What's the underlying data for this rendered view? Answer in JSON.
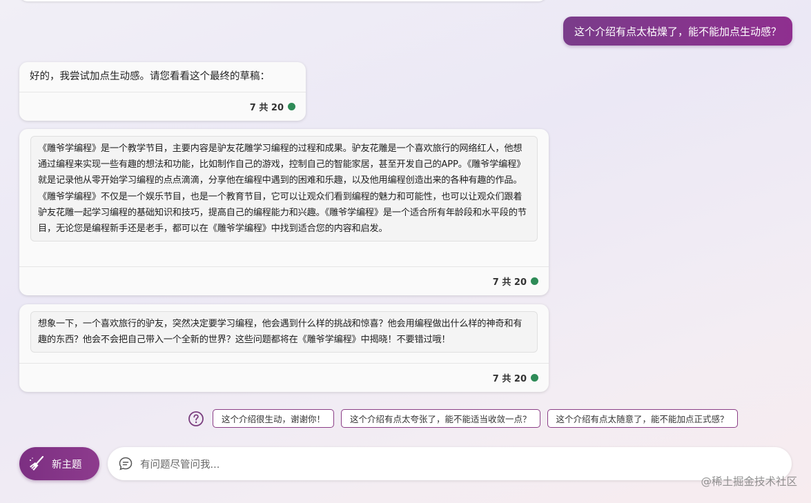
{
  "conversation": {
    "user_message": "这个介绍有点太枯燥了，能不能加点生动感？",
    "response_lead": "好的，我尝试加点生动感。请您看看这个最终的草稿：",
    "intro_paragraph": "《雕爷学编程》是一个教学节目，主要内容是驴友花雕学习编程的过程和成果。驴友花雕是一个喜欢旅行的网络红人，他想通过编程来实现一些有趣的想法和功能，比如制作自己的游戏，控制自己的智能家居，甚至开发自己的APP。《雕爷学编程》就是记录他从零开始学习编程的点点滴滴，分享他在编程中遇到的困难和乐趣，以及他用编程创造出来的各种有趣的作品。《雕爷学编程》不仅是一个娱乐节目，也是一个教育节目，它可以让观众们看到编程的魅力和可能性，也可以让观众们跟着驴友花雕一起学习编程的基础知识和技巧，提高自己的编程能力和兴趣。《雕爷学编程》是一个适合所有年龄段和水平段的节目，无论您是编程新手还是老手，都可以在《雕爷学编程》中找到适合您的内容和启发。",
    "hook_paragraph": "想象一下，一个喜欢旅行的驴友，突然决定要学习编程，他会遇到什么样的挑战和惊喜？他会用编程做出什么样的神奇和有趣的东西？他会不会把自己带入一个全新的世界？这些问题都将在《雕爷学编程》中揭晓！不要错过哦！",
    "turn_counter": "7 共 20",
    "status_color": "#2e8b57"
  },
  "suggestions": {
    "icon": "question-circle-icon",
    "items": [
      "这个介绍很生动，谢谢你！",
      "这个介绍有点太夸张了，能不能适当收敛一点？",
      "这个介绍有点太随意了，能不能加点正式感？"
    ]
  },
  "composer": {
    "new_topic_label": "新主题",
    "new_topic_icon": "broom-icon",
    "input_icon": "chat-bubble-icon",
    "placeholder": "有问题尽管问我..."
  },
  "watermark": "@稀土掘金技术社区",
  "colors": {
    "accent": "#8a3589",
    "status": "#2e8b57"
  }
}
